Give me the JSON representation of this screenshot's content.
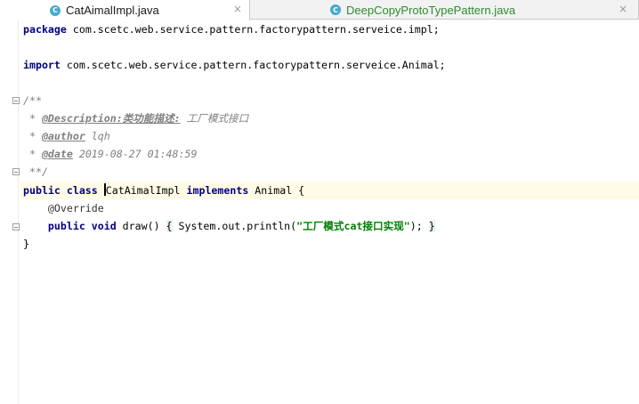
{
  "tabs": [
    {
      "label": "CatAimalImpl.java",
      "icon": "C",
      "active": true,
      "close": "×"
    },
    {
      "label": "DeepCopyProtoTypePattern.java",
      "icon": "C",
      "active": false,
      "close": "×"
    }
  ],
  "code": {
    "l1_kw": "package",
    "l1_rest": " com.scetc.web.service.pattern.factorypattern.serveice.impl;",
    "l3_kw": "import",
    "l3_rest": " com.scetc.web.service.pattern.factorypattern.serveice.Animal;",
    "l5": "/**",
    "l6_star": " * ",
    "l6_tag": "@Description:",
    "l6_tag2": "类功能描述:",
    "l6_rest": " 工厂模式接口",
    "l7_star": " * ",
    "l7_tag": "@author",
    "l7_rest": " lqh",
    "l8_star": " * ",
    "l8_tag": "@date",
    "l8_rest": " 2019-08-27 01:48:59",
    "l9": " **/",
    "l10_kw": "public class",
    "l10_space": " ",
    "l10_name": "CatAimalImpl",
    "l10_space2": " ",
    "l10_kw2": "implements",
    "l10_rest": " Animal {",
    "l11": "    @Override",
    "l12_indent": "    ",
    "l12_kw": "public void",
    "l12_mid": " draw() ",
    "l12_open": "{",
    "l12_call": " System.out.println(",
    "l12_str": "\"工厂模式cat接口实现\"",
    "l12_end": "); ",
    "l12_close": "}",
    "l13": "}"
  },
  "colors": {
    "keyword": "#000080",
    "comment": "#808080",
    "string": "#008000",
    "caret_line": "#fffbe6",
    "tab_icon": "#47a9cf",
    "inactive_tab_text": "#2e8b2e"
  }
}
